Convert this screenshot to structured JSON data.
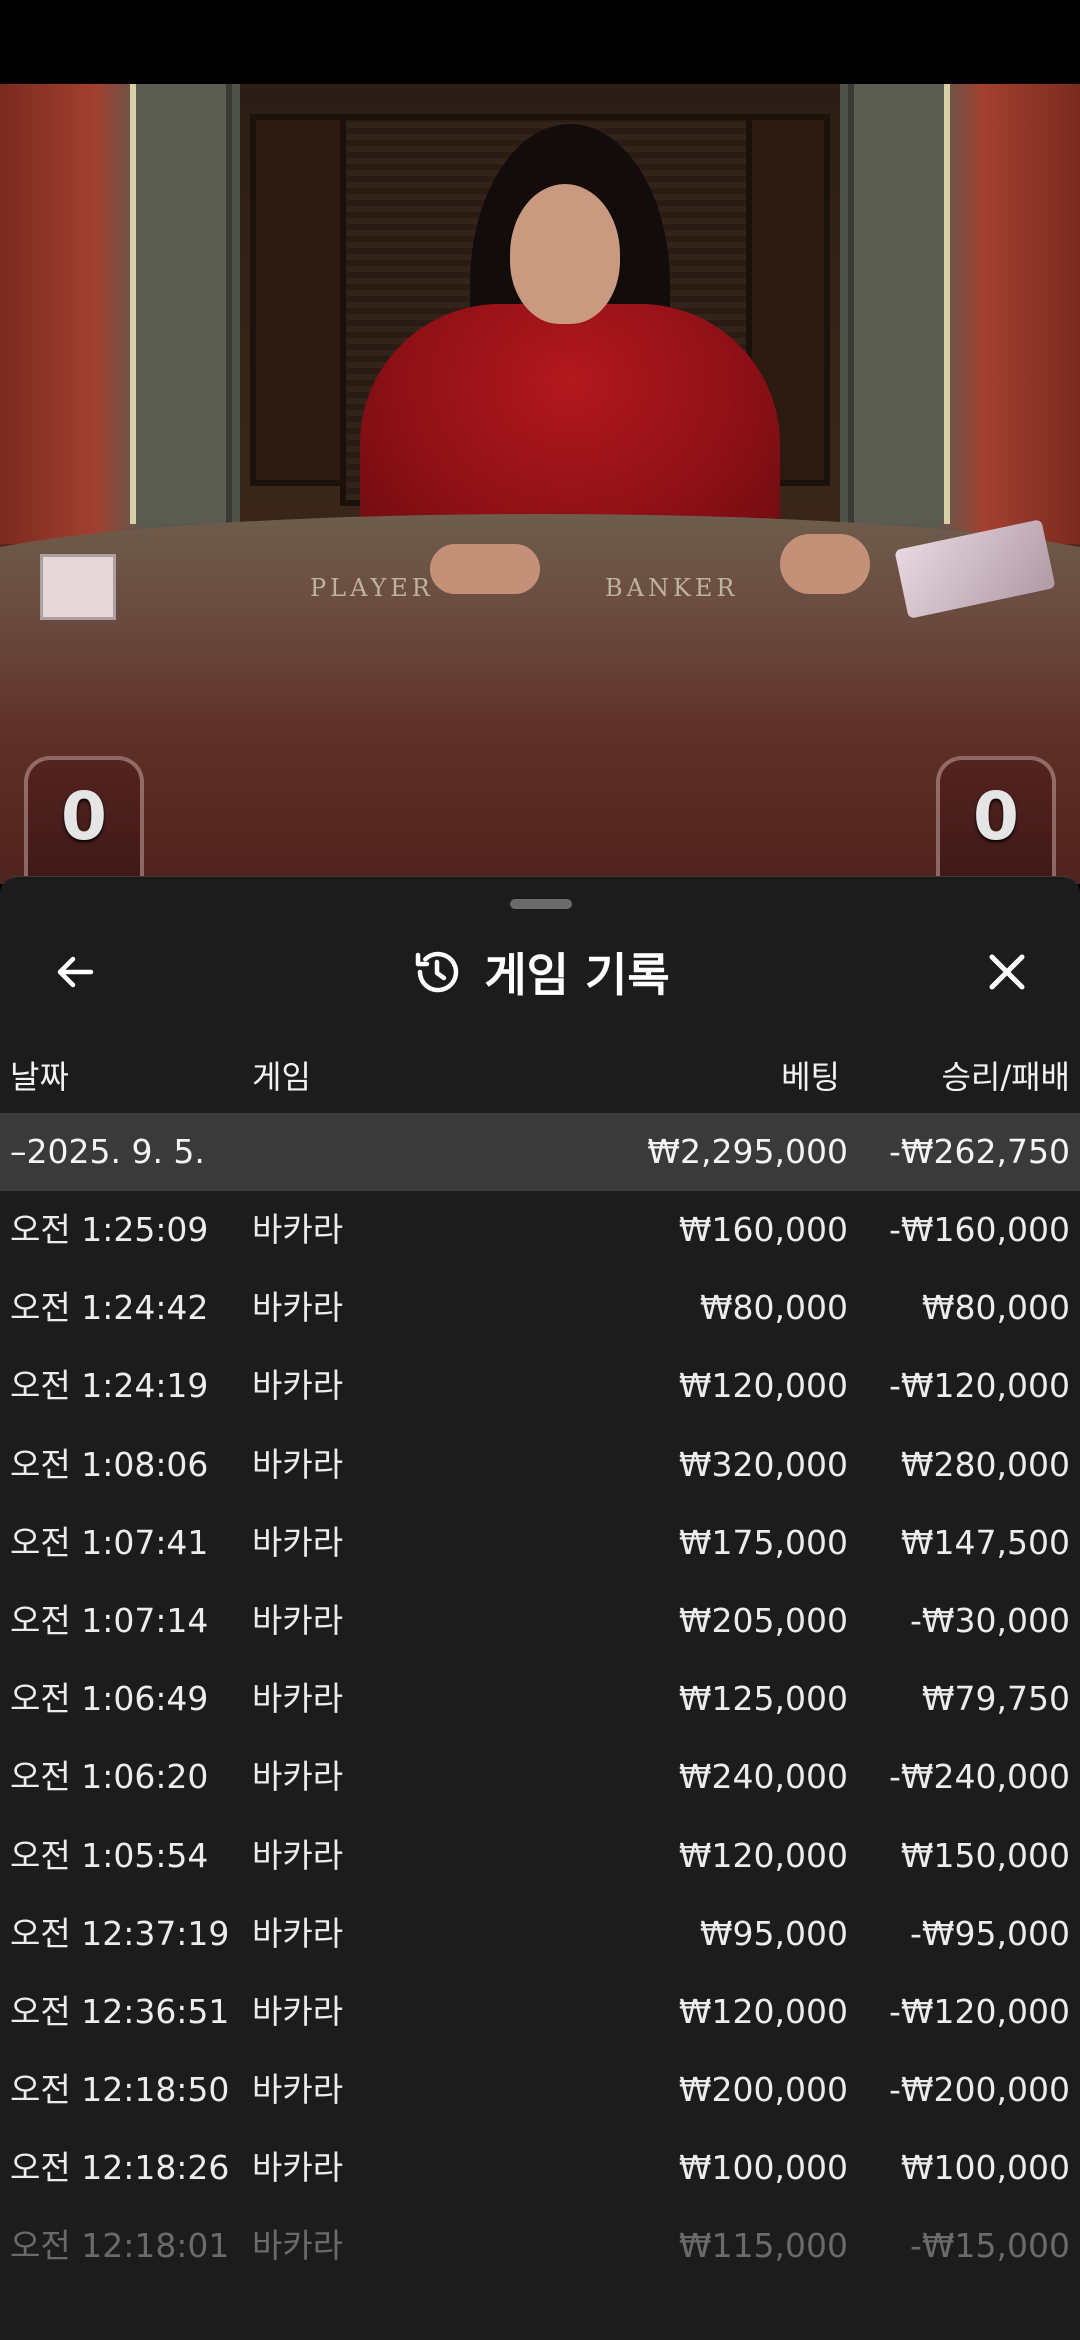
{
  "video": {
    "table_player_label": "PLAYER",
    "table_banker_label": "BANKER",
    "player_score": "0",
    "banker_score": "0"
  },
  "sheet": {
    "title": "게임 기록",
    "icons": {
      "back": "arrow-left-icon",
      "history": "history-icon",
      "close": "close-icon"
    },
    "columns": {
      "date": "날짜",
      "game": "게임",
      "bet": "베팅",
      "win_loss": "승리/패배"
    },
    "group": {
      "date": "–2025. 9. 5.",
      "bet_total": "₩2,295,000",
      "win_total": "-₩262,750"
    },
    "rows": [
      {
        "time": "오전 1:25:09",
        "game": "바카라",
        "bet": "₩160,000",
        "result": "-₩160,000"
      },
      {
        "time": "오전 1:24:42",
        "game": "바카라",
        "bet": "₩80,000",
        "result": "₩80,000"
      },
      {
        "time": "오전 1:24:19",
        "game": "바카라",
        "bet": "₩120,000",
        "result": "-₩120,000"
      },
      {
        "time": "오전 1:08:06",
        "game": "바카라",
        "bet": "₩320,000",
        "result": "₩280,000"
      },
      {
        "time": "오전 1:07:41",
        "game": "바카라",
        "bet": "₩175,000",
        "result": "₩147,500"
      },
      {
        "time": "오전 1:07:14",
        "game": "바카라",
        "bet": "₩205,000",
        "result": "-₩30,000"
      },
      {
        "time": "오전 1:06:49",
        "game": "바카라",
        "bet": "₩125,000",
        "result": "₩79,750"
      },
      {
        "time": "오전 1:06:20",
        "game": "바카라",
        "bet": "₩240,000",
        "result": "-₩240,000"
      },
      {
        "time": "오전 1:05:54",
        "game": "바카라",
        "bet": "₩120,000",
        "result": "₩150,000"
      },
      {
        "time": "오전 12:37:19",
        "game": "바카라",
        "bet": "₩95,000",
        "result": "-₩95,000"
      },
      {
        "time": "오전 12:36:51",
        "game": "바카라",
        "bet": "₩120,000",
        "result": "-₩120,000"
      },
      {
        "time": "오전 12:18:50",
        "game": "바카라",
        "bet": "₩200,000",
        "result": "-₩200,000"
      },
      {
        "time": "오전 12:18:26",
        "game": "바카라",
        "bet": "₩100,000",
        "result": "₩100,000"
      },
      {
        "time": "오전 12:18:01",
        "game": "바카라",
        "bet": "₩115,000",
        "result": "-₩15,000"
      }
    ]
  }
}
